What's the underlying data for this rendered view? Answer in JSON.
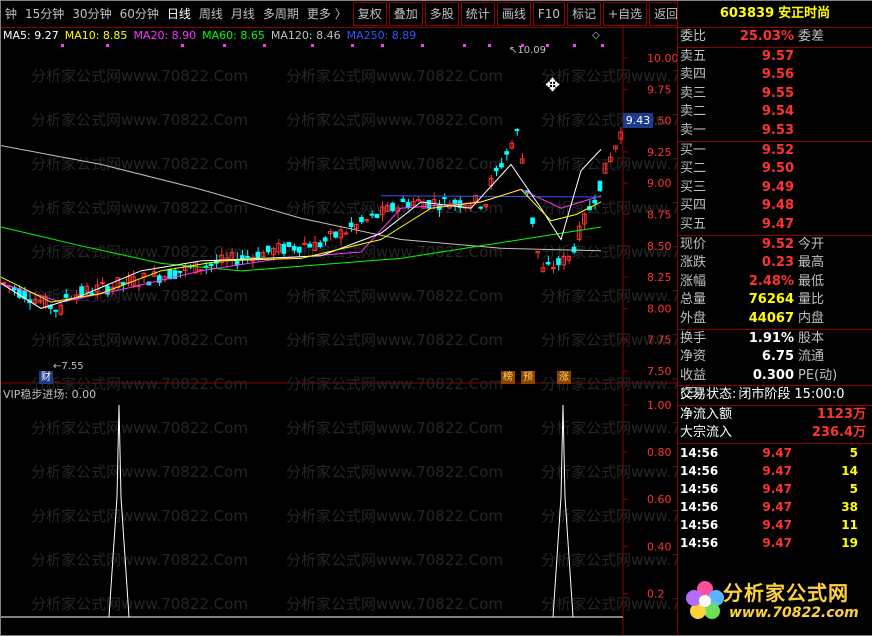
{
  "toolbar": {
    "items": [
      "钟",
      "15分钟",
      "30分钟",
      "60分钟",
      "日线",
      "周线",
      "月线",
      "多周期",
      "更多 〉",
      "复权",
      "叠加",
      "多股",
      "统计",
      "画线",
      "F10",
      "标记",
      "+自选",
      "返回"
    ],
    "active_index": 4
  },
  "ma_legend": [
    {
      "text": "MA5: 9.27",
      "color": "#ffffff"
    },
    {
      "text": "MA10: 8.85",
      "color": "#ffff00"
    },
    {
      "text": "MA20: 8.90",
      "color": "#ff33ff"
    },
    {
      "text": "MA60: 8.65",
      "color": "#00ff00"
    },
    {
      "text": "MA120: 8.46",
      "color": "#c0c0c0"
    },
    {
      "text": "MA250: 8.89",
      "color": "#3355ff"
    }
  ],
  "price_axis": [
    "10.00",
    "9.75",
    "9.50",
    "9.25",
    "9.00",
    "8.75",
    "8.50",
    "8.25",
    "8.00",
    "7.75",
    "7.50"
  ],
  "current_price_tag": "9.43",
  "high_label": "10.09",
  "low_label": "7.55",
  "badges": [
    {
      "text": "财",
      "kind": "cai"
    },
    {
      "text": "榜",
      "kind": "bang"
    },
    {
      "text": "预",
      "kind": "yu"
    },
    {
      "text": "涨",
      "kind": "zhang"
    }
  ],
  "indicator": {
    "label": "VIP稳步进场: 0.00",
    "axis": [
      "1.00",
      "0.80",
      "0.60",
      "0.40",
      "0.2"
    ]
  },
  "stock": {
    "code": "603839",
    "name": "安正时尚"
  },
  "weibi": {
    "label": "委比",
    "value": "25.03%",
    "label2": "委差"
  },
  "asks": [
    {
      "label": "卖五",
      "price": "9.57"
    },
    {
      "label": "卖四",
      "price": "9.56"
    },
    {
      "label": "卖三",
      "price": "9.55"
    },
    {
      "label": "卖二",
      "price": "9.54"
    },
    {
      "label": "卖一",
      "price": "9.53"
    }
  ],
  "bids": [
    {
      "label": "买一",
      "price": "9.52"
    },
    {
      "label": "买二",
      "price": "9.50"
    },
    {
      "label": "买三",
      "price": "9.49"
    },
    {
      "label": "买四",
      "price": "9.48"
    },
    {
      "label": "买五",
      "price": "9.47"
    }
  ],
  "quote": [
    {
      "label": "现价",
      "value": "9.52",
      "label2": "今开",
      "color": "red"
    },
    {
      "label": "涨跌",
      "value": "0.23",
      "label2": "最高",
      "color": "red"
    },
    {
      "label": "涨幅",
      "value": "2.48%",
      "label2": "最低",
      "color": "red"
    },
    {
      "label": "总量",
      "value": "76264",
      "label2": "量比",
      "color": "yel"
    },
    {
      "label": "外盘",
      "value": "44067",
      "label2": "内盘",
      "color": "yel"
    }
  ],
  "fundamentals": [
    {
      "label": "换手",
      "value": "1.91%",
      "label2": "股本"
    },
    {
      "label": "净资",
      "value": "6.75",
      "label2": "流通"
    },
    {
      "label": "收益(三)",
      "value": "0.300",
      "label2": "PE(动)"
    }
  ],
  "trade_status": {
    "label": "交易状态:",
    "state": "闭市阶段",
    "time": "15:00:0"
  },
  "flows": [
    {
      "label": "净流入额",
      "value": "1123万"
    },
    {
      "label": "大宗流入",
      "value": "236.4万"
    }
  ],
  "ticks": [
    {
      "time": "14:56",
      "price": "9.47",
      "vol": "5"
    },
    {
      "time": "14:56",
      "price": "9.47",
      "vol": "14"
    },
    {
      "time": "14:56",
      "price": "9.47",
      "vol": "5"
    },
    {
      "time": "14:56",
      "price": "9.47",
      "vol": "38"
    },
    {
      "time": "14:56",
      "price": "9.47",
      "vol": "11"
    },
    {
      "time": "14:56",
      "price": "9.47",
      "vol": "19"
    }
  ],
  "watermark": "分析家公式网www.70822.Com",
  "logo": {
    "title": "分析家公式网",
    "url": "www.70822.com"
  },
  "colors": {
    "up": "#ff3232",
    "down": "#00ffff",
    "frame": "#8b0000"
  }
}
